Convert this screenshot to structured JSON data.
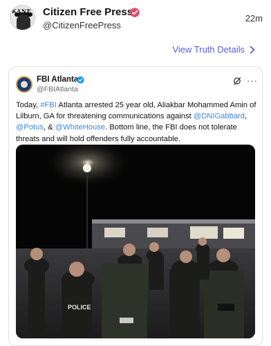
{
  "post": {
    "display_name": "Citizen Free Press",
    "handle": "@CitizenFreePress",
    "timestamp": "22m",
    "view_link": "View Truth Details",
    "avatar_text": "KANE"
  },
  "quoted": {
    "name": "FBI Atlanta",
    "handle": "@FBIAtlanta",
    "more": "···",
    "text": {
      "t1": "Today, ",
      "tag1": "#FBI",
      "t2": " Atlanta arrested 25 year old, Aliakbar Mohammed Amin of Lilburn, GA for threatening communications against ",
      "mention1": "@DNIGabbard",
      "t3": ", ",
      "mention2": "@Potus",
      "t4": ", & ",
      "mention3": "@WhiteHouse",
      "t5": ". Bottom line, the FBI does not tolerate threats and will hold offenders fully accountable."
    },
    "photo": {
      "vest_text": "POLICE"
    }
  },
  "colors": {
    "link": "#3b86e0",
    "view_link": "#5b5bd6",
    "verified": "#e04a6a",
    "fbi_verified": "#1d9bf0"
  },
  "icons": {
    "verified": "verified-badge-icon",
    "chevron": "chevron-right-icon",
    "grok": "grok-icon",
    "more": "more-icon"
  }
}
